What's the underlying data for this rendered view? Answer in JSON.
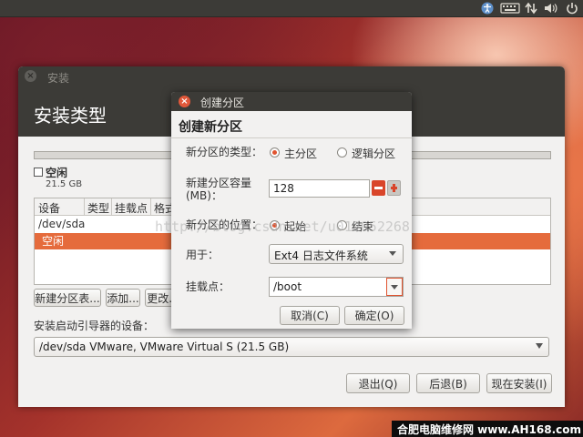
{
  "topbar": {
    "keyboard_label": "",
    "icons": [
      "accessibility-icon",
      "keyboard-icon",
      "network-icon",
      "volume-icon",
      "power-icon"
    ]
  },
  "installer": {
    "window_title": "安装",
    "heading": "安装类型",
    "legend": {
      "label": "空闲",
      "size": "21.5 GB"
    },
    "table": {
      "columns": [
        "设备",
        "类型",
        "挂载点",
        "格式"
      ],
      "rows": [
        {
          "device": "/dev/sda",
          "selected": false
        },
        {
          "device": "空闲",
          "selected": true
        }
      ]
    },
    "buttons": {
      "new_table": "新建分区表...",
      "add": "添加...",
      "change": "更改..."
    },
    "boot_loader_label": "安装启动引导器的设备：",
    "boot_loader_value": "/dev/sda  VMware, VMware Virtual S (21.5 GB)",
    "nav": {
      "quit": "退出(Q)",
      "back": "后退(B)",
      "install_now": "现在安装(I)"
    }
  },
  "dialog": {
    "window_title": "创建分区",
    "heading": "创建新分区",
    "type_label": "新分区的类型：",
    "type_options": [
      "主分区",
      "逻辑分区"
    ],
    "type_selected": 0,
    "size_label_line1": "新建分区容量",
    "size_label_line2": "(MB)：",
    "size_value": "128",
    "location_label": "新分区的位置：",
    "location_options": [
      "起始",
      "结束"
    ],
    "location_selected": 0,
    "use_as_label": "用于：",
    "use_as_value": "Ext4 日志文件系统",
    "mount_label": "挂载点：",
    "mount_value": "/boot",
    "cancel": "取消(C)",
    "ok": "确定(O)"
  },
  "watermark": "http://blog.csdn.net/u012052268",
  "footer": "合肥电脑维修网 www.AH168.com",
  "colors": {
    "accent": "#e56b3c",
    "titlebar": "#3c3b37",
    "close_button": "#e1583a",
    "radio_dot": "#e0532f"
  }
}
